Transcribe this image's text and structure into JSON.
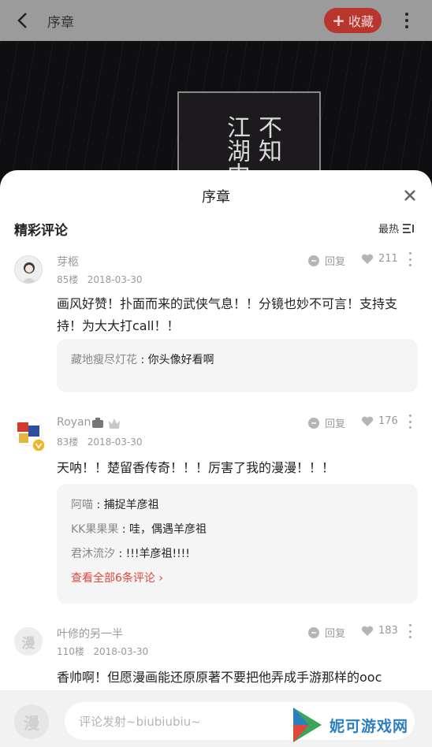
{
  "header": {
    "title": "序章",
    "favorite_label": "收藏",
    "favorite_plus": "+"
  },
  "cover": {
    "col1": "不知",
    "col2": "江湖中"
  },
  "sheet": {
    "title": "序章",
    "section_title": "精彩评论",
    "sort_label": "最热"
  },
  "comments": [
    {
      "user": "芽柩",
      "floor": "85楼",
      "date": "2018-03-30",
      "reply_label": "回复",
      "likes": "211",
      "content": "画风好赞！扑面而来的武侠气息！！分镜也妙不可言！支持支持！为大大打call！！",
      "replies": [
        {
          "name": "藏地瘦尽灯花",
          "sep": " : ",
          "text": "你头像好看啊"
        }
      ]
    },
    {
      "user": "Royan",
      "floor": "83楼",
      "date": "2018-03-30",
      "reply_label": "回复",
      "likes": "176",
      "content": "天呐！！楚留香传奇！！！厉害了我的漫漫！！！",
      "replies": [
        {
          "name": "阿喵",
          "sep": " : ",
          "text": "捕捉羊彦祖"
        },
        {
          "name": "KK果果果",
          "sep": " : ",
          "text": "哇，偶遇羊彦祖"
        },
        {
          "name": "君沐流汐",
          "sep": " : ",
          "text": "!!!羊彦祖!!!!"
        }
      ],
      "view_all": "查看全部6条评论 ›"
    },
    {
      "user": "叶修的另一半",
      "floor": "110楼",
      "date": "2018-03-30",
      "reply_label": "回复",
      "likes": "183",
      "content": "香帅啊！但愿漫画能还原原著不要把他弄成手游那样的ooc",
      "avatar_text": "漫"
    }
  ],
  "input": {
    "placeholder": "评论发射~biubiubiu~",
    "avatar_text": "漫"
  },
  "watermark": {
    "text": "妮可游戏网"
  },
  "colors": {
    "accent": "#e0473b",
    "favorite_bg": "#b9362f",
    "reply_bg": "#f5f5f5",
    "watermark": "#2a7fc1"
  }
}
